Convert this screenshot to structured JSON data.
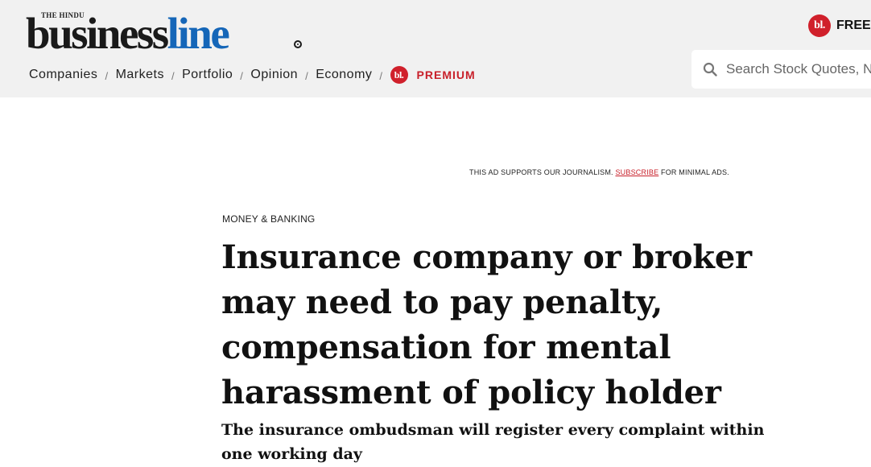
{
  "header": {
    "logo": {
      "small_top": "THE HINDU",
      "word_part1": "business",
      "word_part2": "line"
    },
    "nav": {
      "items": [
        "Companies",
        "Markets",
        "Portfolio",
        "Opinion",
        "Economy"
      ],
      "separator": "/",
      "premium_badge": "bl.",
      "premium_label": "PREMIUM"
    },
    "free": {
      "badge": "bl.",
      "label": "FREE"
    },
    "search": {
      "placeholder": "Search Stock Quotes, N",
      "icon": "search-icon"
    }
  },
  "ad_note": {
    "before": "THIS AD SUPPORTS OUR JOURNALISM. ",
    "link": "SUBSCRIBE",
    "after": " FOR MINIMAL ADS."
  },
  "article": {
    "section": "MONEY & BANKING",
    "headline": "Insurance company or broker may need to pay penalty, compensation for mental harassment of policy holder",
    "subhead": "The insurance ombudsman will register every complaint within one working day"
  },
  "colors": {
    "header_bg": "#f1f1f1",
    "brand_blue": "#1566b8",
    "brand_red": "#d0202b",
    "premium_red": "#c8202a"
  }
}
